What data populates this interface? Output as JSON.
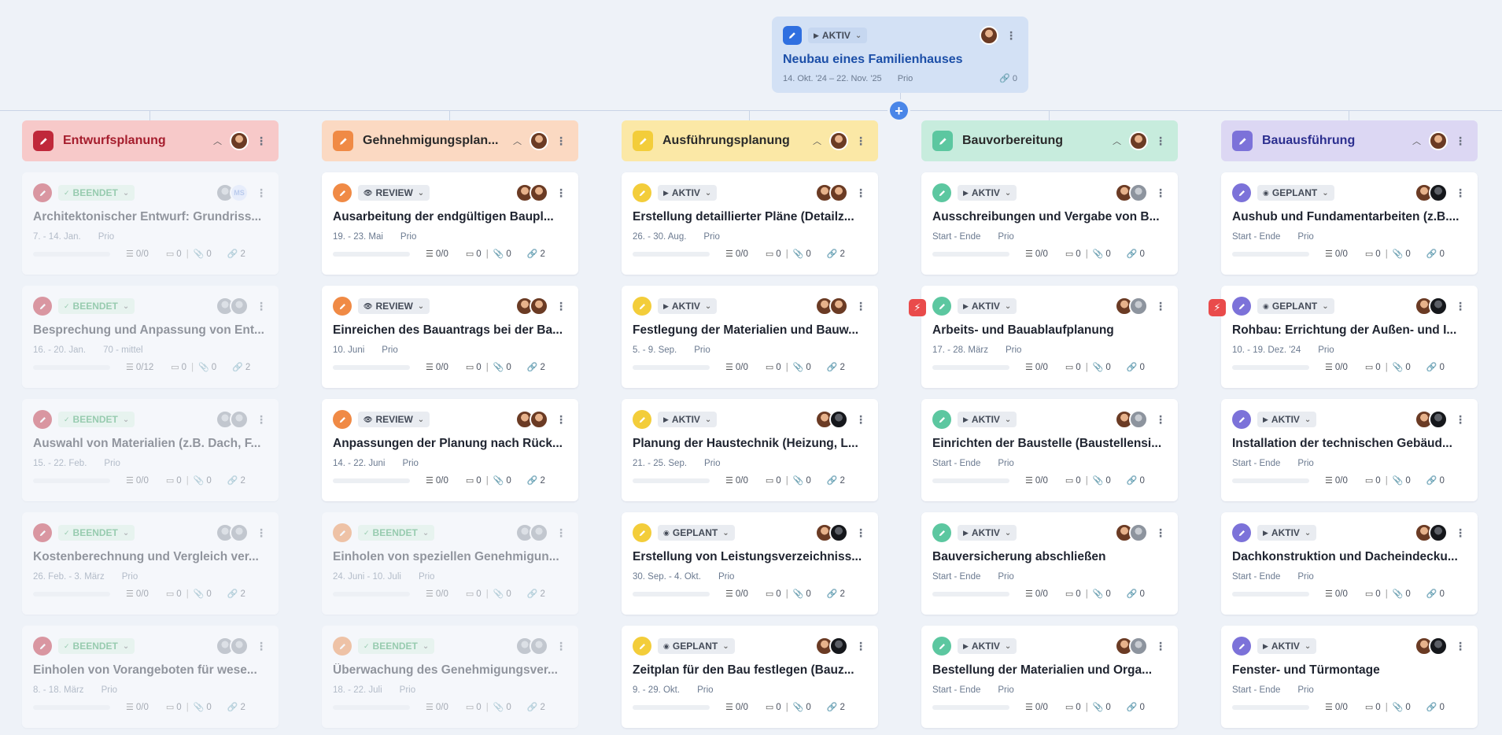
{
  "root": {
    "status": "AKTIV",
    "title": "Neubau eines Familienhauses",
    "dates": "14. Okt. '24 – 22. Nov. '25",
    "prio": "Prio",
    "links": "0",
    "color": "#2f6fe0"
  },
  "add_button": "+",
  "columns": [
    {
      "title": "Entwurfsplanung",
      "header_bg": "#f7c9c9",
      "title_color": "#a51d2d",
      "badge_bg": "#c0283a",
      "cards": [
        {
          "status": "BEENDET",
          "title": "Architektonischer Entwurf: Grundriss...",
          "dates": "7. - 14. Jan.",
          "prio": "Prio",
          "tasks": "0/0",
          "comments": "0",
          "files": "0",
          "links": "2",
          "avatar2": "MS"
        },
        {
          "status": "BEENDET",
          "title": "Besprechung und Anpassung von Ent...",
          "dates": "16. - 20. Jan.",
          "prio": "70 - mittel",
          "tasks": "0/12",
          "comments": "0",
          "files": "0",
          "links": "2"
        },
        {
          "status": "BEENDET",
          "title": "Auswahl von Materialien (z.B. Dach, F...",
          "dates": "15. - 22. Feb.",
          "prio": "Prio",
          "tasks": "0/0",
          "comments": "0",
          "files": "0",
          "links": "2"
        },
        {
          "status": "BEENDET",
          "title": "Kostenberechnung und Vergleich ver...",
          "dates": "26. Feb. - 3. März",
          "prio": "Prio",
          "tasks": "0/0",
          "comments": "0",
          "files": "0",
          "links": "2"
        },
        {
          "status": "BEENDET",
          "title": "Einholen von Vorangeboten für wese...",
          "dates": "8. - 18. März",
          "prio": "Prio",
          "tasks": "0/0",
          "comments": "0",
          "files": "0",
          "links": "2"
        }
      ]
    },
    {
      "title": "Gehnehmigungsplan...",
      "header_bg": "#fbd9c2",
      "title_color": "#2a2a2a",
      "badge_bg": "#f08a45",
      "cards": [
        {
          "status": "REVIEW",
          "title": "Ausarbeitung der endgültigen Baupl...",
          "dates": "19. - 23. Mai",
          "prio": "Prio",
          "tasks": "0/0",
          "comments": "0",
          "files": "0",
          "links": "2"
        },
        {
          "status": "REVIEW",
          "title": "Einreichen des Bauantrags bei der Ba...",
          "dates": "10. Juni",
          "prio": "Prio",
          "tasks": "0/0",
          "comments": "0",
          "files": "0",
          "links": "2"
        },
        {
          "status": "REVIEW",
          "title": "Anpassungen der Planung nach Rück...",
          "dates": "14. - 22. Juni",
          "prio": "Prio",
          "tasks": "0/0",
          "comments": "0",
          "files": "0",
          "links": "2"
        },
        {
          "status": "BEENDET",
          "title": "Einholen von speziellen Genehmigun...",
          "dates": "24. Juni - 10. Juli",
          "prio": "Prio",
          "tasks": "0/0",
          "comments": "0",
          "files": "0",
          "links": "2"
        },
        {
          "status": "BEENDET",
          "title": "Überwachung des Genehmigungsver...",
          "dates": "18. - 22. Juli",
          "prio": "Prio",
          "tasks": "0/0",
          "comments": "0",
          "files": "0",
          "links": "2"
        }
      ]
    },
    {
      "title": "Ausführungsplanung",
      "header_bg": "#fbe8a6",
      "title_color": "#2a2a2a",
      "badge_bg": "#f3cd3a",
      "cards": [
        {
          "status": "AKTIV",
          "title": "Erstellung detaillierter Pläne (Detailz...",
          "dates": "26. - 30. Aug.",
          "prio": "Prio",
          "tasks": "0/0",
          "comments": "0",
          "files": "0",
          "links": "2"
        },
        {
          "status": "AKTIV",
          "title": "Festlegung der Materialien und Bauw...",
          "dates": "5. - 9. Sep.",
          "prio": "Prio",
          "tasks": "0/0",
          "comments": "0",
          "files": "0",
          "links": "2"
        },
        {
          "status": "AKTIV",
          "title": "Planung der Haustechnik (Heizung, L...",
          "dates": "21. - 25. Sep.",
          "prio": "Prio",
          "tasks": "0/0",
          "comments": "0",
          "files": "0",
          "links": "2"
        },
        {
          "status": "GEPLANT",
          "title": "Erstellung von Leistungsverzeichniss...",
          "dates": "30. Sep. - 4. Okt.",
          "prio": "Prio",
          "tasks": "0/0",
          "comments": "0",
          "files": "0",
          "links": "2"
        },
        {
          "status": "GEPLANT",
          "title": "Zeitplan für den Bau festlegen (Bauz...",
          "dates": "9. - 29. Okt.",
          "prio": "Prio",
          "tasks": "0/0",
          "comments": "0",
          "files": "0",
          "links": "2"
        }
      ]
    },
    {
      "title": "Bauvorbereitung",
      "header_bg": "#c7ecdd",
      "title_color": "#2a2a2a",
      "badge_bg": "#5cc7a0",
      "cards": [
        {
          "status": "AKTIV",
          "title": "Ausschreibungen und Vergabe von B...",
          "dates": "Start - Ende",
          "prio": "Prio",
          "tasks": "0/0",
          "comments": "0",
          "files": "0",
          "links": "0"
        },
        {
          "status": "AKTIV",
          "title": "Arbeits- und Bauablaufplanung",
          "dates": "17. - 28. März",
          "prio": "Prio",
          "tasks": "0/0",
          "comments": "0",
          "files": "0",
          "links": "0",
          "flash": "⚡"
        },
        {
          "status": "AKTIV",
          "title": "Einrichten der Baustelle (Baustellensi...",
          "dates": "Start - Ende",
          "prio": "Prio",
          "tasks": "0/0",
          "comments": "0",
          "files": "0",
          "links": "0"
        },
        {
          "status": "AKTIV",
          "title": "Bauversicherung abschließen",
          "dates": "Start - Ende",
          "prio": "Prio",
          "tasks": "0/0",
          "comments": "0",
          "files": "0",
          "links": "0"
        },
        {
          "status": "AKTIV",
          "title": "Bestellung der Materialien und Orga...",
          "dates": "Start - Ende",
          "prio": "Prio",
          "tasks": "0/0",
          "comments": "0",
          "files": "0",
          "links": "0"
        }
      ]
    },
    {
      "title": "Bauausführung",
      "header_bg": "#dcd7f3",
      "title_color": "#2c2f8f",
      "badge_bg": "#7c72d9",
      "cards": [
        {
          "status": "GEPLANT",
          "title": "Aushub und Fundamentarbeiten (z.B....",
          "dates": "Start - Ende",
          "prio": "Prio",
          "tasks": "0/0",
          "comments": "0",
          "files": "0",
          "links": "0"
        },
        {
          "status": "GEPLANT",
          "title": "Rohbau: Errichtung der Außen- und I...",
          "dates": "10. - 19. Dez. '24",
          "prio": "Prio",
          "tasks": "0/0",
          "comments": "0",
          "files": "0",
          "links": "0",
          "flash": "⚡"
        },
        {
          "status": "AKTIV",
          "title": "Installation der technischen Gebäud...",
          "dates": "Start - Ende",
          "prio": "Prio",
          "tasks": "0/0",
          "comments": "0",
          "files": "0",
          "links": "0"
        },
        {
          "status": "AKTIV",
          "title": "Dachkonstruktion und Dacheindecku...",
          "dates": "Start - Ende",
          "prio": "Prio",
          "tasks": "0/0",
          "comments": "0",
          "files": "0",
          "links": "0"
        },
        {
          "status": "AKTIV",
          "title": "Fenster- und Türmontage",
          "dates": "Start - Ende",
          "prio": "Prio",
          "tasks": "0/0",
          "comments": "0",
          "files": "0",
          "links": "0"
        }
      ]
    }
  ]
}
